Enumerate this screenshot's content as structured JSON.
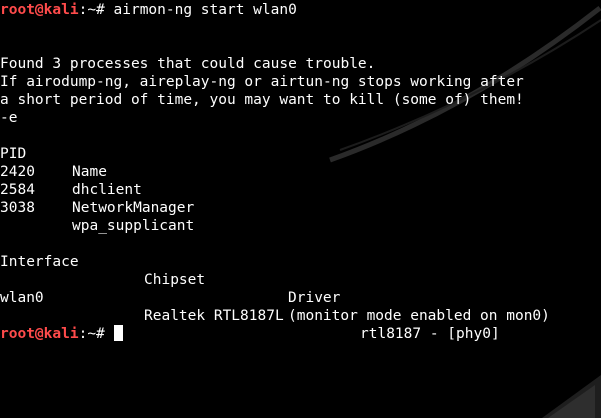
{
  "terminal": {
    "prompt": {
      "user_host": "root@kali",
      "separator": ":",
      "path": "~",
      "symbol": "#"
    },
    "command": " airmon-ng start wlan0",
    "output": {
      "warning_line1": "Found 3 processes that could cause trouble.",
      "warning_line2": "If airodump-ng, aireplay-ng or airtun-ng stops working after",
      "warning_line3": "a short period of time, you may want to kill (some of) them!",
      "echo_flag": "-e",
      "process_header": {
        "pid": "PID",
        "name": "Name"
      },
      "processes": [
        {
          "pid": "2420",
          "name": "dhclient"
        },
        {
          "pid": "2584",
          "name": "NetworkManager"
        },
        {
          "pid": "3038",
          "name": "wpa_supplicant"
        }
      ],
      "interface_header": {
        "interface": "Interface",
        "chipset": "Chipset",
        "driver": "Driver"
      },
      "interfaces": [
        {
          "interface": "wlan0",
          "chipset": "Realtek RTL8187L",
          "driver": "rtl8187 - [phy0]"
        }
      ],
      "monitor_note": "(monitor mode enabled on mon0)"
    }
  },
  "colors": {
    "background": "#000000",
    "text": "#ffffff",
    "prompt_user": "#ff4b4b"
  }
}
